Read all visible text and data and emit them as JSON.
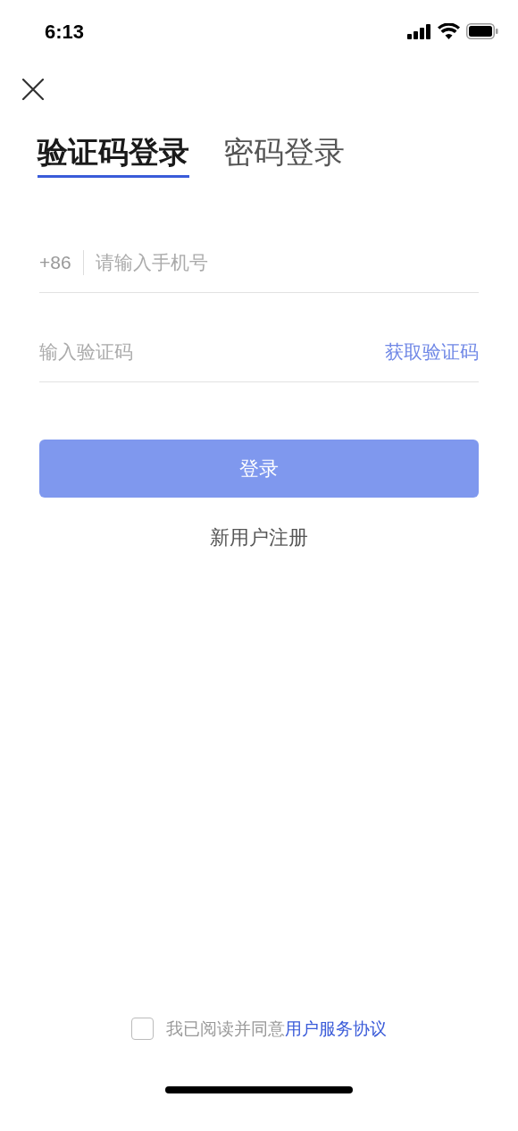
{
  "status_bar": {
    "time": "6:13"
  },
  "tabs": [
    {
      "label": "验证码登录",
      "selected": true
    },
    {
      "label": "密码登录",
      "selected": false
    }
  ],
  "phone_field": {
    "prefix": "+86",
    "placeholder": "请输入手机号"
  },
  "code_field": {
    "placeholder": "输入验证码",
    "action": "获取验证码"
  },
  "login_button": {
    "label": "登录",
    "disabled": true
  },
  "register_link": "新用户注册",
  "agreement": {
    "checked": false,
    "text": "我已阅读并同意",
    "link": "用户服务协议"
  }
}
